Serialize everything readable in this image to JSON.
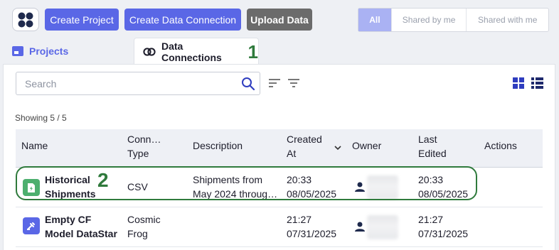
{
  "toolbar": {
    "create_project": "Create Project",
    "create_data_connection": "Create Data Connection",
    "upload_data": "Upload Data"
  },
  "filters": [
    "All",
    "Shared by me",
    "Shared with me"
  ],
  "tabs": {
    "projects": "Projects",
    "data_connections": "Data Connections",
    "step_marker": "1"
  },
  "search": {
    "placeholder": "Search"
  },
  "showing": "Showing 5 / 5",
  "table": {
    "headers": {
      "name": "Name",
      "conn_type": "Conn…\nType",
      "description": "Description",
      "created_at": "Created\nAt",
      "owner": "Owner",
      "last_edited": "Last\nEdited",
      "actions": "Actions"
    },
    "rows": [
      {
        "name": "Historical\nShipments",
        "type": "CSV",
        "description": "Shipments from\nMay 2024 throug…",
        "created": "20:33\n08/05/2025",
        "edited": "20:33\n08/05/2025"
      },
      {
        "name": "Empty CF\nModel DataStar",
        "type": "Cosmic\nFrog",
        "description": "",
        "created": "21:27\n07/31/2025",
        "edited": "21:27\n07/31/2025"
      }
    ]
  },
  "annotations": {
    "step2": "2"
  },
  "colors": {
    "accent": "#5a67e6",
    "highlight": "#2f7a3c",
    "csv_icon": "#4caf6e",
    "cosmic_icon": "#5a67e6"
  }
}
